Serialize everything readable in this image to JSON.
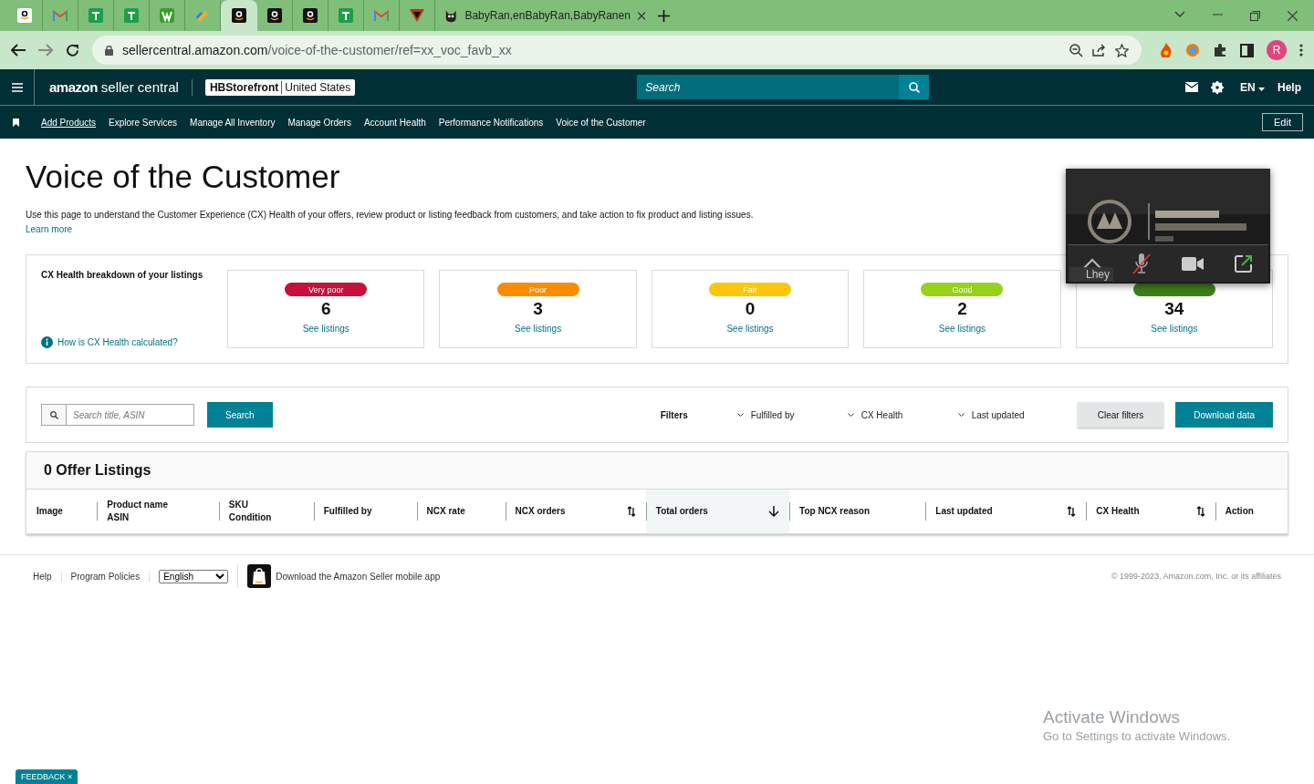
{
  "browser": {
    "tabs": [
      {
        "kind": "amazon",
        "selected": false
      },
      {
        "kind": "gmail",
        "selected": false
      },
      {
        "kind": "sheets",
        "selected": false
      },
      {
        "kind": "sheets",
        "selected": false
      },
      {
        "kind": "w",
        "selected": false
      },
      {
        "kind": "pen",
        "selected": false
      },
      {
        "kind": "amazon-dark",
        "selected": true
      },
      {
        "kind": "amazon-dark",
        "selected": false
      },
      {
        "kind": "amazon-dark",
        "selected": false
      },
      {
        "kind": "sheets",
        "selected": false
      },
      {
        "kind": "gmail",
        "selected": false
      },
      {
        "kind": "triangle",
        "selected": false
      },
      {
        "kind": "cat",
        "selected": false,
        "title": "BabyRan,enBabyRan,BabyRanen"
      }
    ],
    "url_host": "sellercentral.amazon.com",
    "url_path": "/voice-of-the-customer/ref=xx_voc_favb_xx",
    "profile": "R"
  },
  "header": {
    "logo_main": "amazon",
    "logo_sub": "seller central",
    "store": "HBStorefront",
    "marketplace": "United States",
    "search_placeholder": "Search",
    "language": "EN",
    "help": "Help"
  },
  "nav": {
    "items": [
      {
        "label": "Add Products",
        "selected": true
      },
      {
        "label": "Explore Services",
        "selected": false
      },
      {
        "label": "Manage All Inventory",
        "selected": false
      },
      {
        "label": "Manage Orders",
        "selected": false
      },
      {
        "label": "Account Health",
        "selected": false
      },
      {
        "label": "Performance Notifications",
        "selected": false
      },
      {
        "label": "Voice of the Customer",
        "selected": false
      }
    ],
    "edit": "Edit"
  },
  "page": {
    "title": "Voice of the Customer",
    "intro": "Use this page to understand the Customer Experience (CX) Health of your offers, review product or listing feedback from customers, and take action to fix product and listing issues.",
    "learn_more": "Learn more"
  },
  "breakdown": {
    "title": "CX Health breakdown of your listings",
    "help_link": "How is CX Health calculated?",
    "cards": [
      {
        "label": "Very poor",
        "color": "#c7113a",
        "count": "6",
        "link": "See listings"
      },
      {
        "label": "Poor",
        "color": "#fb8c00",
        "count": "3",
        "link": "See listings"
      },
      {
        "label": "Fair",
        "color": "#fdc60a",
        "count": "0",
        "link": "See listings"
      },
      {
        "label": "Good",
        "color": "#98d11c",
        "count": "2",
        "link": "See listings"
      },
      {
        "color": "#3d7f19",
        "count": "34",
        "link": "See listings"
      }
    ]
  },
  "filters": {
    "search_placeholder": "Search title, ASIN",
    "search_button": "Search",
    "label": "Filters",
    "dropdowns": [
      "Fulfilled by",
      "CX Health",
      "Last updated"
    ],
    "clear": "Clear filters",
    "download": "Download data"
  },
  "table": {
    "title": "0 Offer Listings",
    "columns": [
      {
        "lines": [
          "Image"
        ],
        "kind": "plain",
        "highlighted": false
      },
      {
        "lines": [
          "Product name",
          "ASIN"
        ],
        "kind": "plain",
        "highlighted": false
      },
      {
        "lines": [
          "SKU",
          "Condition"
        ],
        "kind": "plain",
        "highlighted": false
      },
      {
        "lines": [
          "Fulfilled by"
        ],
        "kind": "plain",
        "highlighted": false
      },
      {
        "lines": [
          "NCX rate"
        ],
        "kind": "plain",
        "highlighted": false
      },
      {
        "lines": [
          "NCX orders"
        ],
        "kind": "both",
        "highlighted": false
      },
      {
        "lines": [
          "Total orders"
        ],
        "kind": "down",
        "highlighted": true
      },
      {
        "lines": [
          "Top NCX reason"
        ],
        "kind": "plain",
        "highlighted": false
      },
      {
        "lines": [
          "Last updated"
        ],
        "kind": "both",
        "highlighted": false
      },
      {
        "lines": [
          "CX Health"
        ],
        "kind": "both",
        "highlighted": false
      },
      {
        "lines": [
          "Action"
        ],
        "kind": "plain",
        "highlighted": false
      }
    ]
  },
  "footer": {
    "links": [
      "Help",
      "Program Policies"
    ],
    "language": "English",
    "app": "Download the Amazon Seller mobile app",
    "copyright": "© 1999-2023, Amazon.com, Inc. or its affiliates"
  },
  "video_overlay": {
    "participant": "Lhey",
    "mic_muted": true
  },
  "os_watermark": {
    "title": "Activate Windows",
    "subtitle": "Go to Settings to activate Windows."
  },
  "feedback": "FEEDBACK ×"
}
